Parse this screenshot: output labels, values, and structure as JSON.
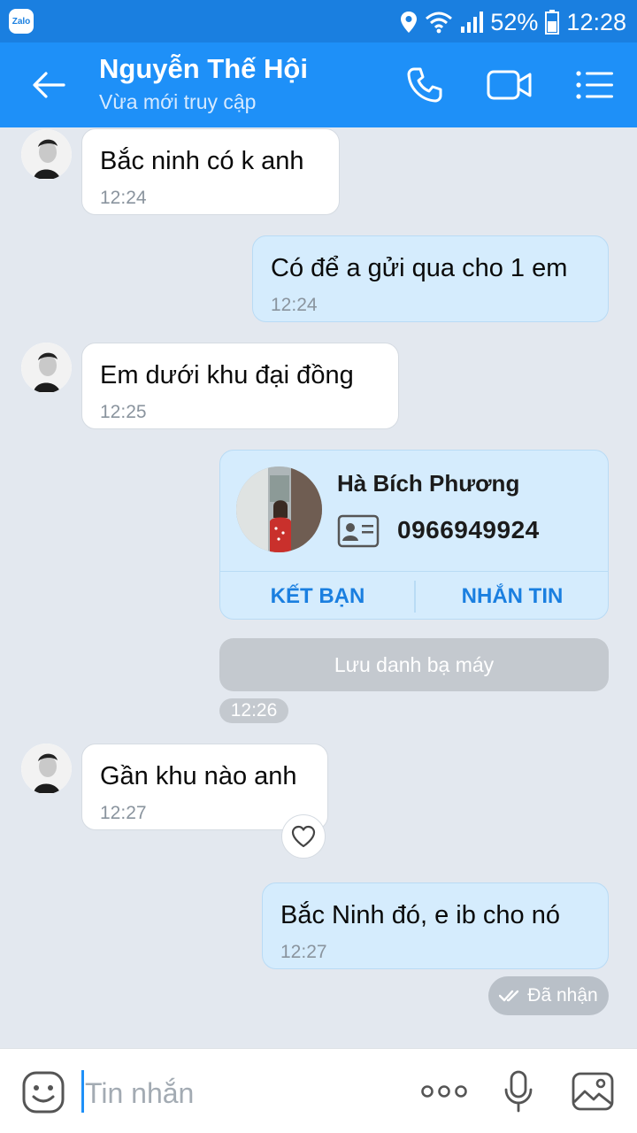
{
  "status_bar": {
    "app_badge": "Zalo",
    "battery": "52%",
    "time": "12:28"
  },
  "header": {
    "name": "Nguyễn Thế Hội",
    "status": "Vừa mới truy cập"
  },
  "messages": [
    {
      "text": "Bắc ninh có k anh",
      "time": "12:24"
    },
    {
      "text": "Có để a gửi qua cho 1 em",
      "time": "12:24"
    },
    {
      "text": "Em dưới khu đại đồng",
      "time": "12:25"
    },
    {
      "text": "Gần khu nào anh",
      "time": "12:27"
    },
    {
      "text": "Bắc Ninh đó, e ib cho nó",
      "time": "12:27"
    }
  ],
  "contact_card": {
    "name": "Hà Bích Phương",
    "phone": "0966949924",
    "add_friend": "KẾT BẠN",
    "message": "NHẮN TIN",
    "save_contact": "Lưu danh bạ máy",
    "time": "12:26"
  },
  "delivery_status": "Đã nhận",
  "composer": {
    "placeholder": "Tin nhắn"
  },
  "colors": {
    "header": "#1e90f8",
    "status_bar": "#1a7fe0",
    "background": "#e3e8ef",
    "outgoing_bubble": "#d5ecfd",
    "accent": "#1a7fe0"
  },
  "icons": [
    "back-arrow-icon",
    "phone-icon",
    "video-icon",
    "menu-list-icon",
    "heart-icon",
    "emoji-icon",
    "more-icon",
    "mic-icon",
    "image-icon",
    "contact-id-icon",
    "double-check-icon"
  ]
}
